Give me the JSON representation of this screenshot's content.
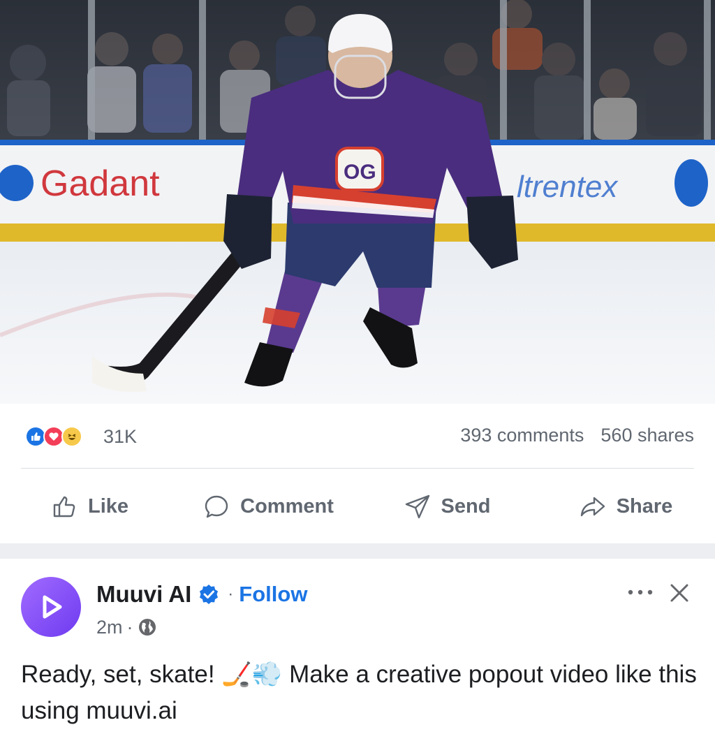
{
  "stats": {
    "reaction_count": "31K",
    "comments": "393 comments",
    "shares": "560 shares",
    "reaction_icons": [
      "like-icon",
      "love-icon",
      "haha-icon"
    ]
  },
  "actions": {
    "like": "Like",
    "comment": "Comment",
    "send": "Send",
    "share": "Share"
  },
  "next_post": {
    "page_name": "Muuvi AI",
    "follow": "Follow",
    "time": "2m",
    "text_before": "Ready, set, skate! ",
    "emojis": "🏒💨",
    "text_after": " Make a creative popout video like this using muuvi.ai"
  },
  "hero_image": {
    "board_left": "Gadant",
    "board_right": "ltrentex"
  },
  "colors": {
    "accent": "#1b74e4",
    "muted_text": "#606770",
    "like": "#1b74e4",
    "love": "#f33e58",
    "haha": "#f7c94b"
  }
}
